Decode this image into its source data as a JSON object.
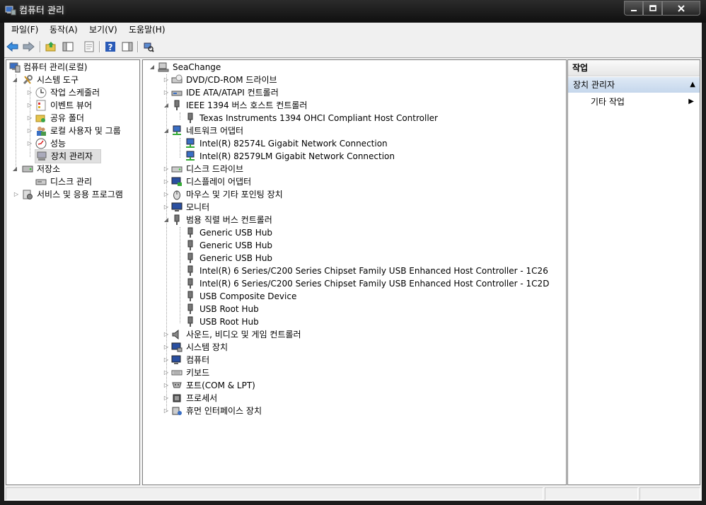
{
  "window": {
    "title": "컴퓨터 관리",
    "icons": [
      "computer-management-icon",
      "minimize-icon",
      "maximize-icon",
      "close-icon"
    ]
  },
  "menu": [
    "파일(F)",
    "동작(A)",
    "보기(V)",
    "도움말(H)"
  ],
  "toolbar": [
    "back-icon",
    "forward-icon",
    "up-folder-icon",
    "show-hide-console-tree-icon",
    "properties-icon",
    "help-icon",
    "show-hide-action-pane-icon",
    "scan-hardware-icon"
  ],
  "left_tree": [
    {
      "label": "컴퓨터 관리(로컬)",
      "icon": "computer-management-icon"
    },
    {
      "label": "시스템 도구",
      "icon": "tools-icon"
    },
    {
      "label": "작업 스케줄러",
      "icon": "clock-icon"
    },
    {
      "label": "이벤트 뷰어",
      "icon": "event-viewer-icon"
    },
    {
      "label": "공유 폴더",
      "icon": "shared-folder-icon"
    },
    {
      "label": "로컬 사용자 및 그룹",
      "icon": "users-icon"
    },
    {
      "label": "성능",
      "icon": "performance-icon"
    },
    {
      "label": "장치 관리자",
      "icon": "device-manager-icon"
    },
    {
      "label": "저장소",
      "icon": "storage-icon"
    },
    {
      "label": "디스크 관리",
      "icon": "disk-icon"
    },
    {
      "label": "서비스 및 응용 프로그램",
      "icon": "services-icon"
    }
  ],
  "device_tree": {
    "root": "SeaChange",
    "items": [
      "DVD/CD-ROM 드라이브",
      "IDE ATA/ATAPI 컨트롤러",
      "IEEE 1394 버스 호스트 컨트롤러",
      "Texas Instruments 1394 OHCI Compliant Host Controller",
      "네트워크 어댑터",
      "Intel(R) 82574L Gigabit Network Connection",
      "Intel(R) 82579LM Gigabit Network Connection",
      "디스크 드라이브",
      "디스플레이 어댑터",
      "마우스 및 기타 포인팅 장치",
      "모니터",
      "범용 직렬 버스 컨트롤러",
      "Generic USB Hub",
      "Generic USB Hub",
      "Generic USB Hub",
      "Intel(R) 6 Series/C200 Series Chipset Family USB Enhanced Host Controller - 1C26",
      "Intel(R) 6 Series/C200 Series Chipset Family USB Enhanced Host Controller - 1C2D",
      "USB Composite Device",
      "USB Root Hub",
      "USB Root Hub",
      "사운드, 비디오 및 게임 컨트롤러",
      "시스템 장치",
      "컴퓨터",
      "키보드",
      "포트(COM & LPT)",
      "프로세서",
      "휴먼 인터페이스 장치"
    ]
  },
  "actions": {
    "header": "작업",
    "section": "장치 관리자",
    "item": "기타 작업"
  }
}
